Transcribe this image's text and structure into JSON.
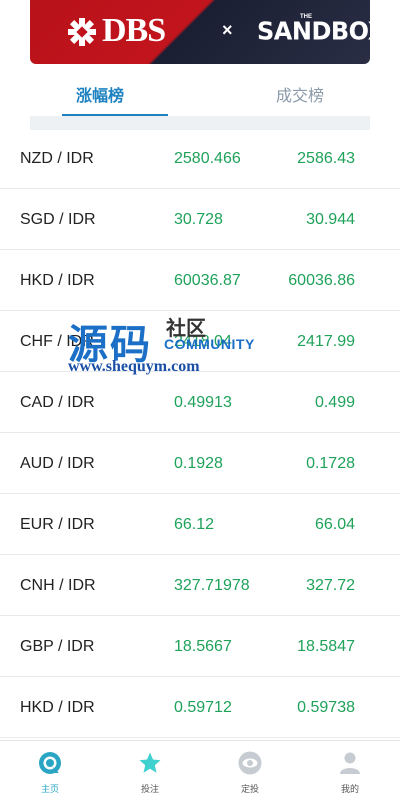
{
  "banner": {
    "brand": "DBS",
    "separator": "×",
    "partner": "SANDBOX",
    "partner_prefix": "THE"
  },
  "tabs": [
    {
      "label": "涨幅榜",
      "active": true
    },
    {
      "label": "成交榜",
      "active": false
    }
  ],
  "rows": [
    {
      "pair": "NZD / IDR",
      "v1": "2580.466",
      "v2": "2586.43"
    },
    {
      "pair": "SGD / IDR",
      "v1": "30.728",
      "v2": "30.944"
    },
    {
      "pair": "HKD / IDR",
      "v1": "60036.87",
      "v2": "60036.86"
    },
    {
      "pair": "CHF / IDR",
      "v1": "2418.04",
      "v2": "2417.99"
    },
    {
      "pair": "CAD / IDR",
      "v1": "0.49913",
      "v2": "0.499"
    },
    {
      "pair": "AUD / IDR",
      "v1": "0.1928",
      "v2": "0.1728"
    },
    {
      "pair": "EUR / IDR",
      "v1": "66.12",
      "v2": "66.04"
    },
    {
      "pair": "CNH / IDR",
      "v1": "327.71978",
      "v2": "327.72"
    },
    {
      "pair": "GBP / IDR",
      "v1": "18.5667",
      "v2": "18.5847"
    },
    {
      "pair": "HKD / IDR",
      "v1": "0.59712",
      "v2": "0.59738"
    }
  ],
  "watermark": {
    "big": "源码",
    "small": "社区",
    "community": "COMMUNITY",
    "url": "www.shequym.com"
  },
  "nav": [
    {
      "label": "主页",
      "icon": "home-icon",
      "active": true
    },
    {
      "label": "投注",
      "icon": "star-icon",
      "active": false
    },
    {
      "label": "定投",
      "icon": "eye-icon",
      "active": false
    },
    {
      "label": "我的",
      "icon": "user-icon",
      "active": false
    }
  ],
  "colors": {
    "accent": "#1f82c0",
    "up": "#1fa25a",
    "nav_active": "#2aa6c4"
  }
}
